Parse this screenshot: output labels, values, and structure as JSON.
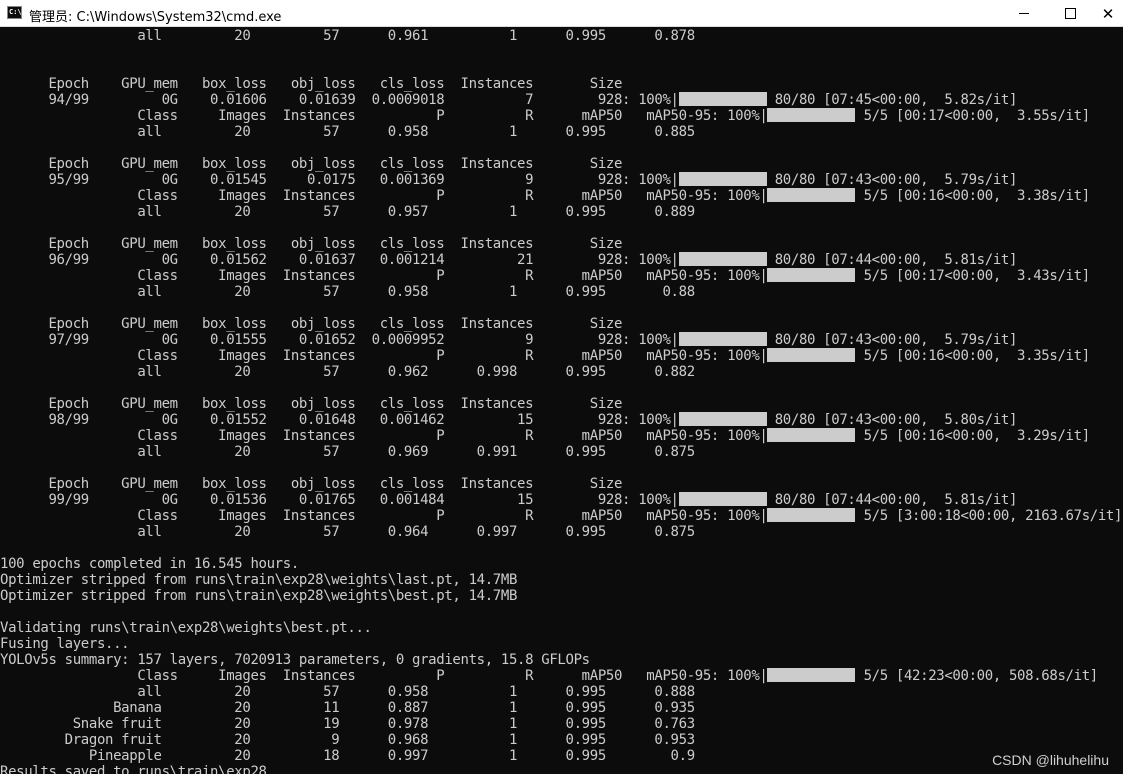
{
  "window": {
    "title": "管理员: C:\\Windows\\System32\\cmd.exe",
    "icon": "cmd-icon",
    "minimize_label": "—",
    "maximize_label": "☐",
    "close_label": "✕"
  },
  "console": {
    "lines": [
      {
        "text": "                 all         20         57      0.961          1      0.995      0.878"
      },
      {
        "text": ""
      },
      {
        "text": ""
      },
      {
        "text": "      Epoch    GPU_mem   box_loss   obj_loss   cls_loss  Instances       Size"
      },
      {
        "text": "      94/99         0G    0.01606    0.01639  0.0009018          7        928: 100%|",
        "bar": 11,
        "after": " 80/80 [07:45<00:00,  5.82s/it]"
      },
      {
        "text": "                 Class     Images  Instances          P          R      mAP50   mAP50-95: 100%|",
        "bar": 11,
        "after": " 5/5 [00:17<00:00,  3.55s/it]"
      },
      {
        "text": "                 all         20         57      0.958          1      0.995      0.885"
      },
      {
        "text": ""
      },
      {
        "text": "      Epoch    GPU_mem   box_loss   obj_loss   cls_loss  Instances       Size"
      },
      {
        "text": "      95/99         0G    0.01545     0.0175   0.001369          9        928: 100%|",
        "bar": 11,
        "after": " 80/80 [07:43<00:00,  5.79s/it]"
      },
      {
        "text": "                 Class     Images  Instances          P          R      mAP50   mAP50-95: 100%|",
        "bar": 11,
        "after": " 5/5 [00:16<00:00,  3.38s/it]"
      },
      {
        "text": "                 all         20         57      0.957          1      0.995      0.889"
      },
      {
        "text": ""
      },
      {
        "text": "      Epoch    GPU_mem   box_loss   obj_loss   cls_loss  Instances       Size"
      },
      {
        "text": "      96/99         0G    0.01562    0.01637   0.001214         21        928: 100%|",
        "bar": 11,
        "after": " 80/80 [07:44<00:00,  5.81s/it]"
      },
      {
        "text": "                 Class     Images  Instances          P          R      mAP50   mAP50-95: 100%|",
        "bar": 11,
        "after": " 5/5 [00:17<00:00,  3.43s/it]"
      },
      {
        "text": "                 all         20         57      0.958          1      0.995       0.88"
      },
      {
        "text": ""
      },
      {
        "text": "      Epoch    GPU_mem   box_loss   obj_loss   cls_loss  Instances       Size"
      },
      {
        "text": "      97/99         0G    0.01555    0.01652  0.0009952          9        928: 100%|",
        "bar": 11,
        "after": " 80/80 [07:43<00:00,  5.79s/it]"
      },
      {
        "text": "                 Class     Images  Instances          P          R      mAP50   mAP50-95: 100%|",
        "bar": 11,
        "after": " 5/5 [00:16<00:00,  3.35s/it]"
      },
      {
        "text": "                 all         20         57      0.962      0.998      0.995      0.882"
      },
      {
        "text": ""
      },
      {
        "text": "      Epoch    GPU_mem   box_loss   obj_loss   cls_loss  Instances       Size"
      },
      {
        "text": "      98/99         0G    0.01552    0.01648   0.001462         15        928: 100%|",
        "bar": 11,
        "after": " 80/80 [07:43<00:00,  5.80s/it]"
      },
      {
        "text": "                 Class     Images  Instances          P          R      mAP50   mAP50-95: 100%|",
        "bar": 11,
        "after": " 5/5 [00:16<00:00,  3.29s/it]"
      },
      {
        "text": "                 all         20         57      0.969      0.991      0.995      0.875"
      },
      {
        "text": ""
      },
      {
        "text": "      Epoch    GPU_mem   box_loss   obj_loss   cls_loss  Instances       Size"
      },
      {
        "text": "      99/99         0G    0.01536    0.01765   0.001484         15        928: 100%|",
        "bar": 11,
        "after": " 80/80 [07:44<00:00,  5.81s/it]"
      },
      {
        "text": "                 Class     Images  Instances          P          R      mAP50   mAP50-95: 100%|",
        "bar": 11,
        "after": " 5/5 [3:00:18<00:00, 2163.67s/it]"
      },
      {
        "text": "                 all         20         57      0.964      0.997      0.995      0.875"
      },
      {
        "text": ""
      },
      {
        "text": "100 epochs completed in 16.545 hours."
      },
      {
        "text": "Optimizer stripped from runs\\train\\exp28\\weights\\last.pt, 14.7MB"
      },
      {
        "text": "Optimizer stripped from runs\\train\\exp28\\weights\\best.pt, 14.7MB"
      },
      {
        "text": ""
      },
      {
        "text": "Validating runs\\train\\exp28\\weights\\best.pt..."
      },
      {
        "text": "Fusing layers..."
      },
      {
        "text": "YOLOv5s summary: 157 layers, 7020913 parameters, 0 gradients, 15.8 GFLOPs"
      },
      {
        "text": "                 Class     Images  Instances          P          R      mAP50   mAP50-95: 100%|",
        "bar": 11,
        "after": " 5/5 [42:23<00:00, 508.68s/it]"
      },
      {
        "text": "                 all         20         57      0.958          1      0.995      0.888"
      },
      {
        "text": "              Banana         20         11      0.887          1      0.995      0.935"
      },
      {
        "text": "         Snake fruit         20         19      0.978          1      0.995      0.763"
      },
      {
        "text": "        Dragon fruit         20          9      0.968          1      0.995      0.953"
      },
      {
        "text": "           Pineapple         20         18      0.997          1      0.995        0.9"
      },
      {
        "text": "Results saved to runs\\train\\exp28"
      }
    ]
  },
  "watermark": "CSDN @lihuhelihu"
}
